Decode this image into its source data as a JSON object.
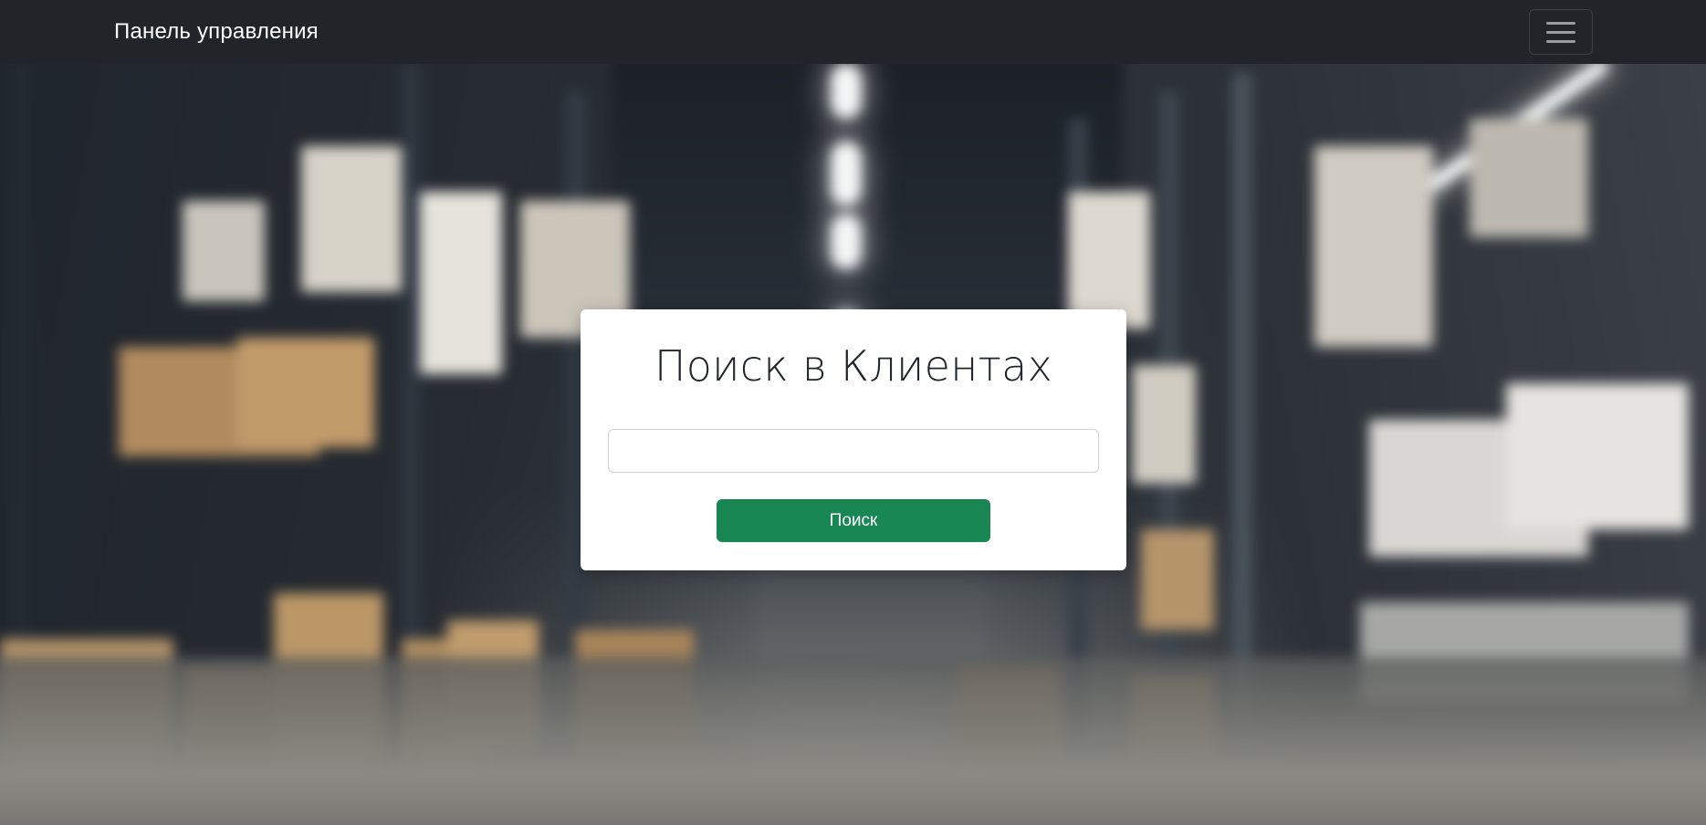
{
  "navbar": {
    "brand": "Панель управления",
    "toggler_icon": "hamburger-menu-icon"
  },
  "search": {
    "title": "Поиск в Клиентах",
    "input_value": "",
    "input_placeholder": "",
    "button_label": "Поиск"
  },
  "colors": {
    "navbar_bg": "#212529",
    "button_green": "#198754",
    "card_bg": "#ffffff"
  }
}
